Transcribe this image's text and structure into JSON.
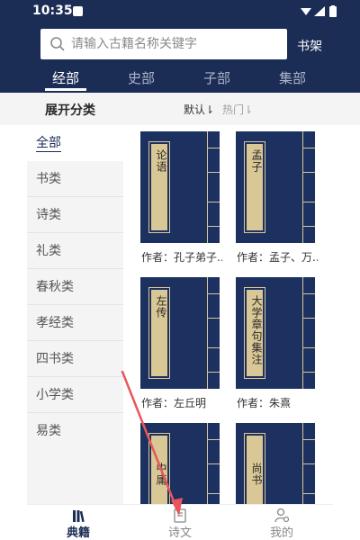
{
  "status": {
    "time": "10:35"
  },
  "search": {
    "placeholder": "请输入古籍名称关键字"
  },
  "header": {
    "shelf_label": "书架"
  },
  "top_tabs": [
    {
      "label": "经部",
      "active": true
    },
    {
      "label": "史部",
      "active": false
    },
    {
      "label": "子部",
      "active": false
    },
    {
      "label": "集部",
      "active": false
    }
  ],
  "filter": {
    "title": "展开分类",
    "sort_default": "默认",
    "sort_hot": "热门"
  },
  "sidebar": {
    "items": [
      {
        "label": "全部",
        "active": true
      },
      {
        "label": "书类"
      },
      {
        "label": "诗类"
      },
      {
        "label": "礼类"
      },
      {
        "label": "春秋类"
      },
      {
        "label": "孝经类"
      },
      {
        "label": "四书类"
      },
      {
        "label": "小学类"
      },
      {
        "label": "易类"
      }
    ]
  },
  "books": [
    {
      "title": "论语",
      "author": "作者：孔子弟子..."
    },
    {
      "title": "孟子",
      "author": "作者：孟子、万..."
    },
    {
      "title": "左传",
      "author": "作者：左丘明"
    },
    {
      "title": "大学章句集注",
      "author": "作者：朱熹"
    },
    {
      "title": "中庸",
      "author": ""
    },
    {
      "title": "尚书",
      "author": ""
    }
  ],
  "bottom_nav": [
    {
      "label": "典籍",
      "icon": "books-icon",
      "active": true
    },
    {
      "label": "诗文",
      "icon": "document-icon",
      "active": false
    },
    {
      "label": "我的",
      "icon": "profile-icon",
      "active": false
    }
  ],
  "colors": {
    "primary": "#1b2d55",
    "book_cover": "#1c3160",
    "label_paper": "#d9c795",
    "annotation_arrow": "#e8565b"
  }
}
